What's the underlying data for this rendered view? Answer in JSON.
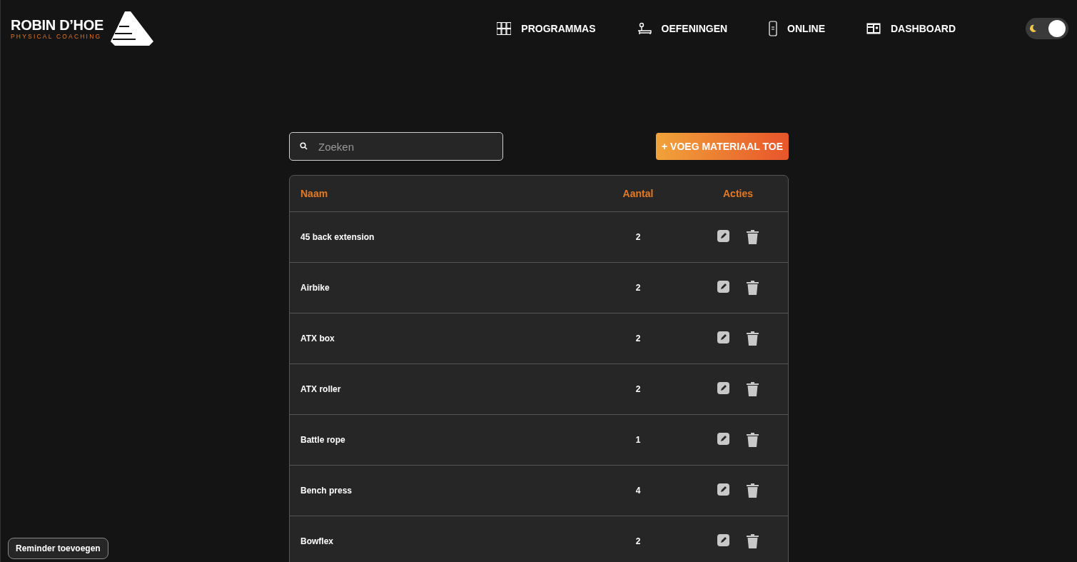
{
  "logo": {
    "name": "ROBIN D’HOE",
    "tagline": "PHYSICAL COACHING"
  },
  "nav": [
    {
      "label": "PROGRAMMAS",
      "kind": "grid"
    },
    {
      "label": "OEFENINGEN",
      "kind": "bench"
    },
    {
      "label": "ONLINE",
      "kind": "phone"
    },
    {
      "label": "DASHBOARD",
      "kind": "card"
    }
  ],
  "theme_toggle": {
    "on": true
  },
  "search": {
    "placeholder": "Zoeken"
  },
  "add_button": "+ VOEG MATERIAAL TOE",
  "table": {
    "columns": [
      "Naam",
      "Aantal",
      "Acties"
    ],
    "rows": [
      {
        "name": "45 back extension",
        "count": "2"
      },
      {
        "name": "Airbike",
        "count": "2"
      },
      {
        "name": "ATX box",
        "count": "2"
      },
      {
        "name": "ATX roller",
        "count": "2"
      },
      {
        "name": "Battle rope",
        "count": "1"
      },
      {
        "name": "Bench press",
        "count": "4"
      },
      {
        "name": "Bowflex",
        "count": "2"
      }
    ]
  },
  "reminder_button": "Reminder toevoegen"
}
